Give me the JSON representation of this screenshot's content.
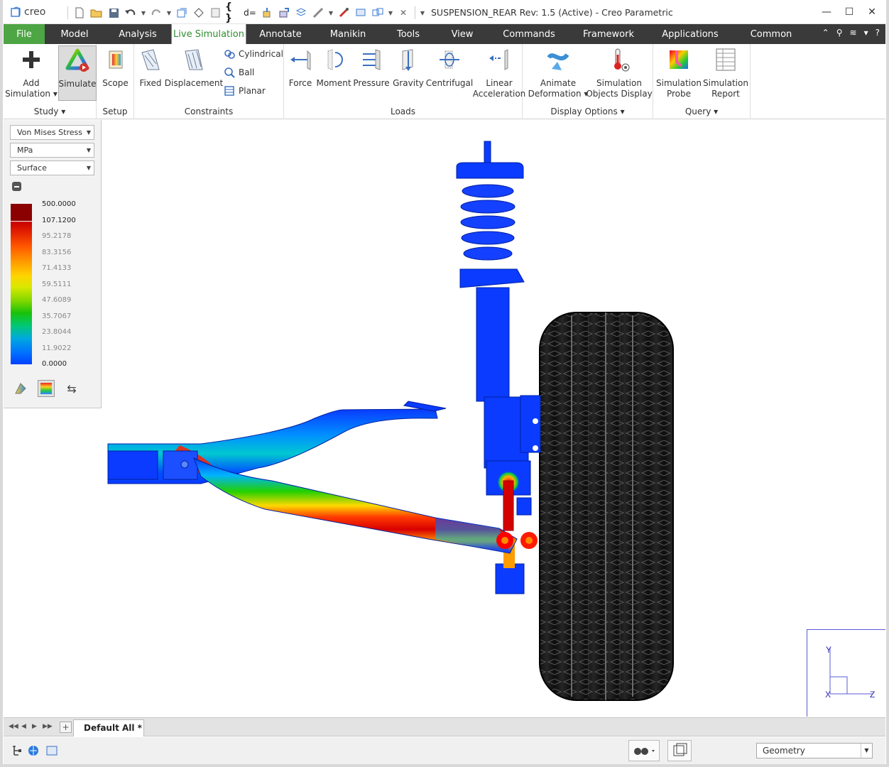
{
  "app": {
    "logo_text": "creo",
    "window_title": "SUSPENSION_REAR Rev: 1.5 (Active) - Creo Parametric"
  },
  "quick_access": [
    "new-icon",
    "open-icon",
    "save-icon",
    "undo-icon",
    "redo-icon",
    "regenerate-icon",
    "windows-icon",
    "close-window-icon",
    "braces-icon",
    "d-equals-icon",
    "relations-icon",
    "parameters-icon",
    "layers-icon",
    "measure-icon",
    "appearance-icon",
    "display-icon",
    "more-icon",
    "stop-icon"
  ],
  "tabs": [
    {
      "label": "File"
    },
    {
      "label": "Model"
    },
    {
      "label": "Analysis"
    },
    {
      "label": "Live Simulation"
    },
    {
      "label": "Annotate"
    },
    {
      "label": "Manikin"
    },
    {
      "label": "Tools"
    },
    {
      "label": "View"
    },
    {
      "label": "Commands"
    },
    {
      "label": "Framework"
    },
    {
      "label": "Applications"
    },
    {
      "label": "Common"
    }
  ],
  "ribbon": {
    "study": {
      "group_label": "Study",
      "add_simulation": "Add\nSimulation",
      "simulate": "Simulate"
    },
    "setup": {
      "group_label": "Setup",
      "scope": "Scope"
    },
    "constraints": {
      "group_label": "Constraints",
      "fixed": "Fixed",
      "displacement": "Displacement",
      "cylindrical": "Cylindrical",
      "ball": "Ball",
      "planar": "Planar"
    },
    "loads": {
      "group_label": "Loads",
      "force": "Force",
      "moment": "Moment",
      "pressure": "Pressure",
      "gravity": "Gravity",
      "centrifugal": "Centrifugal",
      "linear_acceleration": "Linear\nAcceleration"
    },
    "display_options": {
      "group_label": "Display Options",
      "animate_deformation": "Animate\nDeformation",
      "simulation_objects_display": "Simulation\nObjects Display"
    },
    "query": {
      "group_label": "Query",
      "simulation_probe": "Simulation\nProbe",
      "simulation_report": "Simulation\nReport"
    }
  },
  "legend": {
    "quantity": "Von Mises Stress",
    "units": "MPa",
    "display": "Surface",
    "values": [
      "500.0000",
      "107.1200",
      "95.2178",
      "83.3156",
      "71.4133",
      "59.5111",
      "47.6089",
      "35.7067",
      "23.8044",
      "11.9022",
      "0.0000"
    ],
    "colors": {
      "max": "#8b0000",
      "high": "#c80000",
      "mid": "#18c20a",
      "low": "#0040ff"
    }
  },
  "triad": {
    "y": "Y",
    "x": "X",
    "z": "Z"
  },
  "model_tab": {
    "label": "Default All *"
  },
  "status": {
    "filter": "Geometry"
  }
}
